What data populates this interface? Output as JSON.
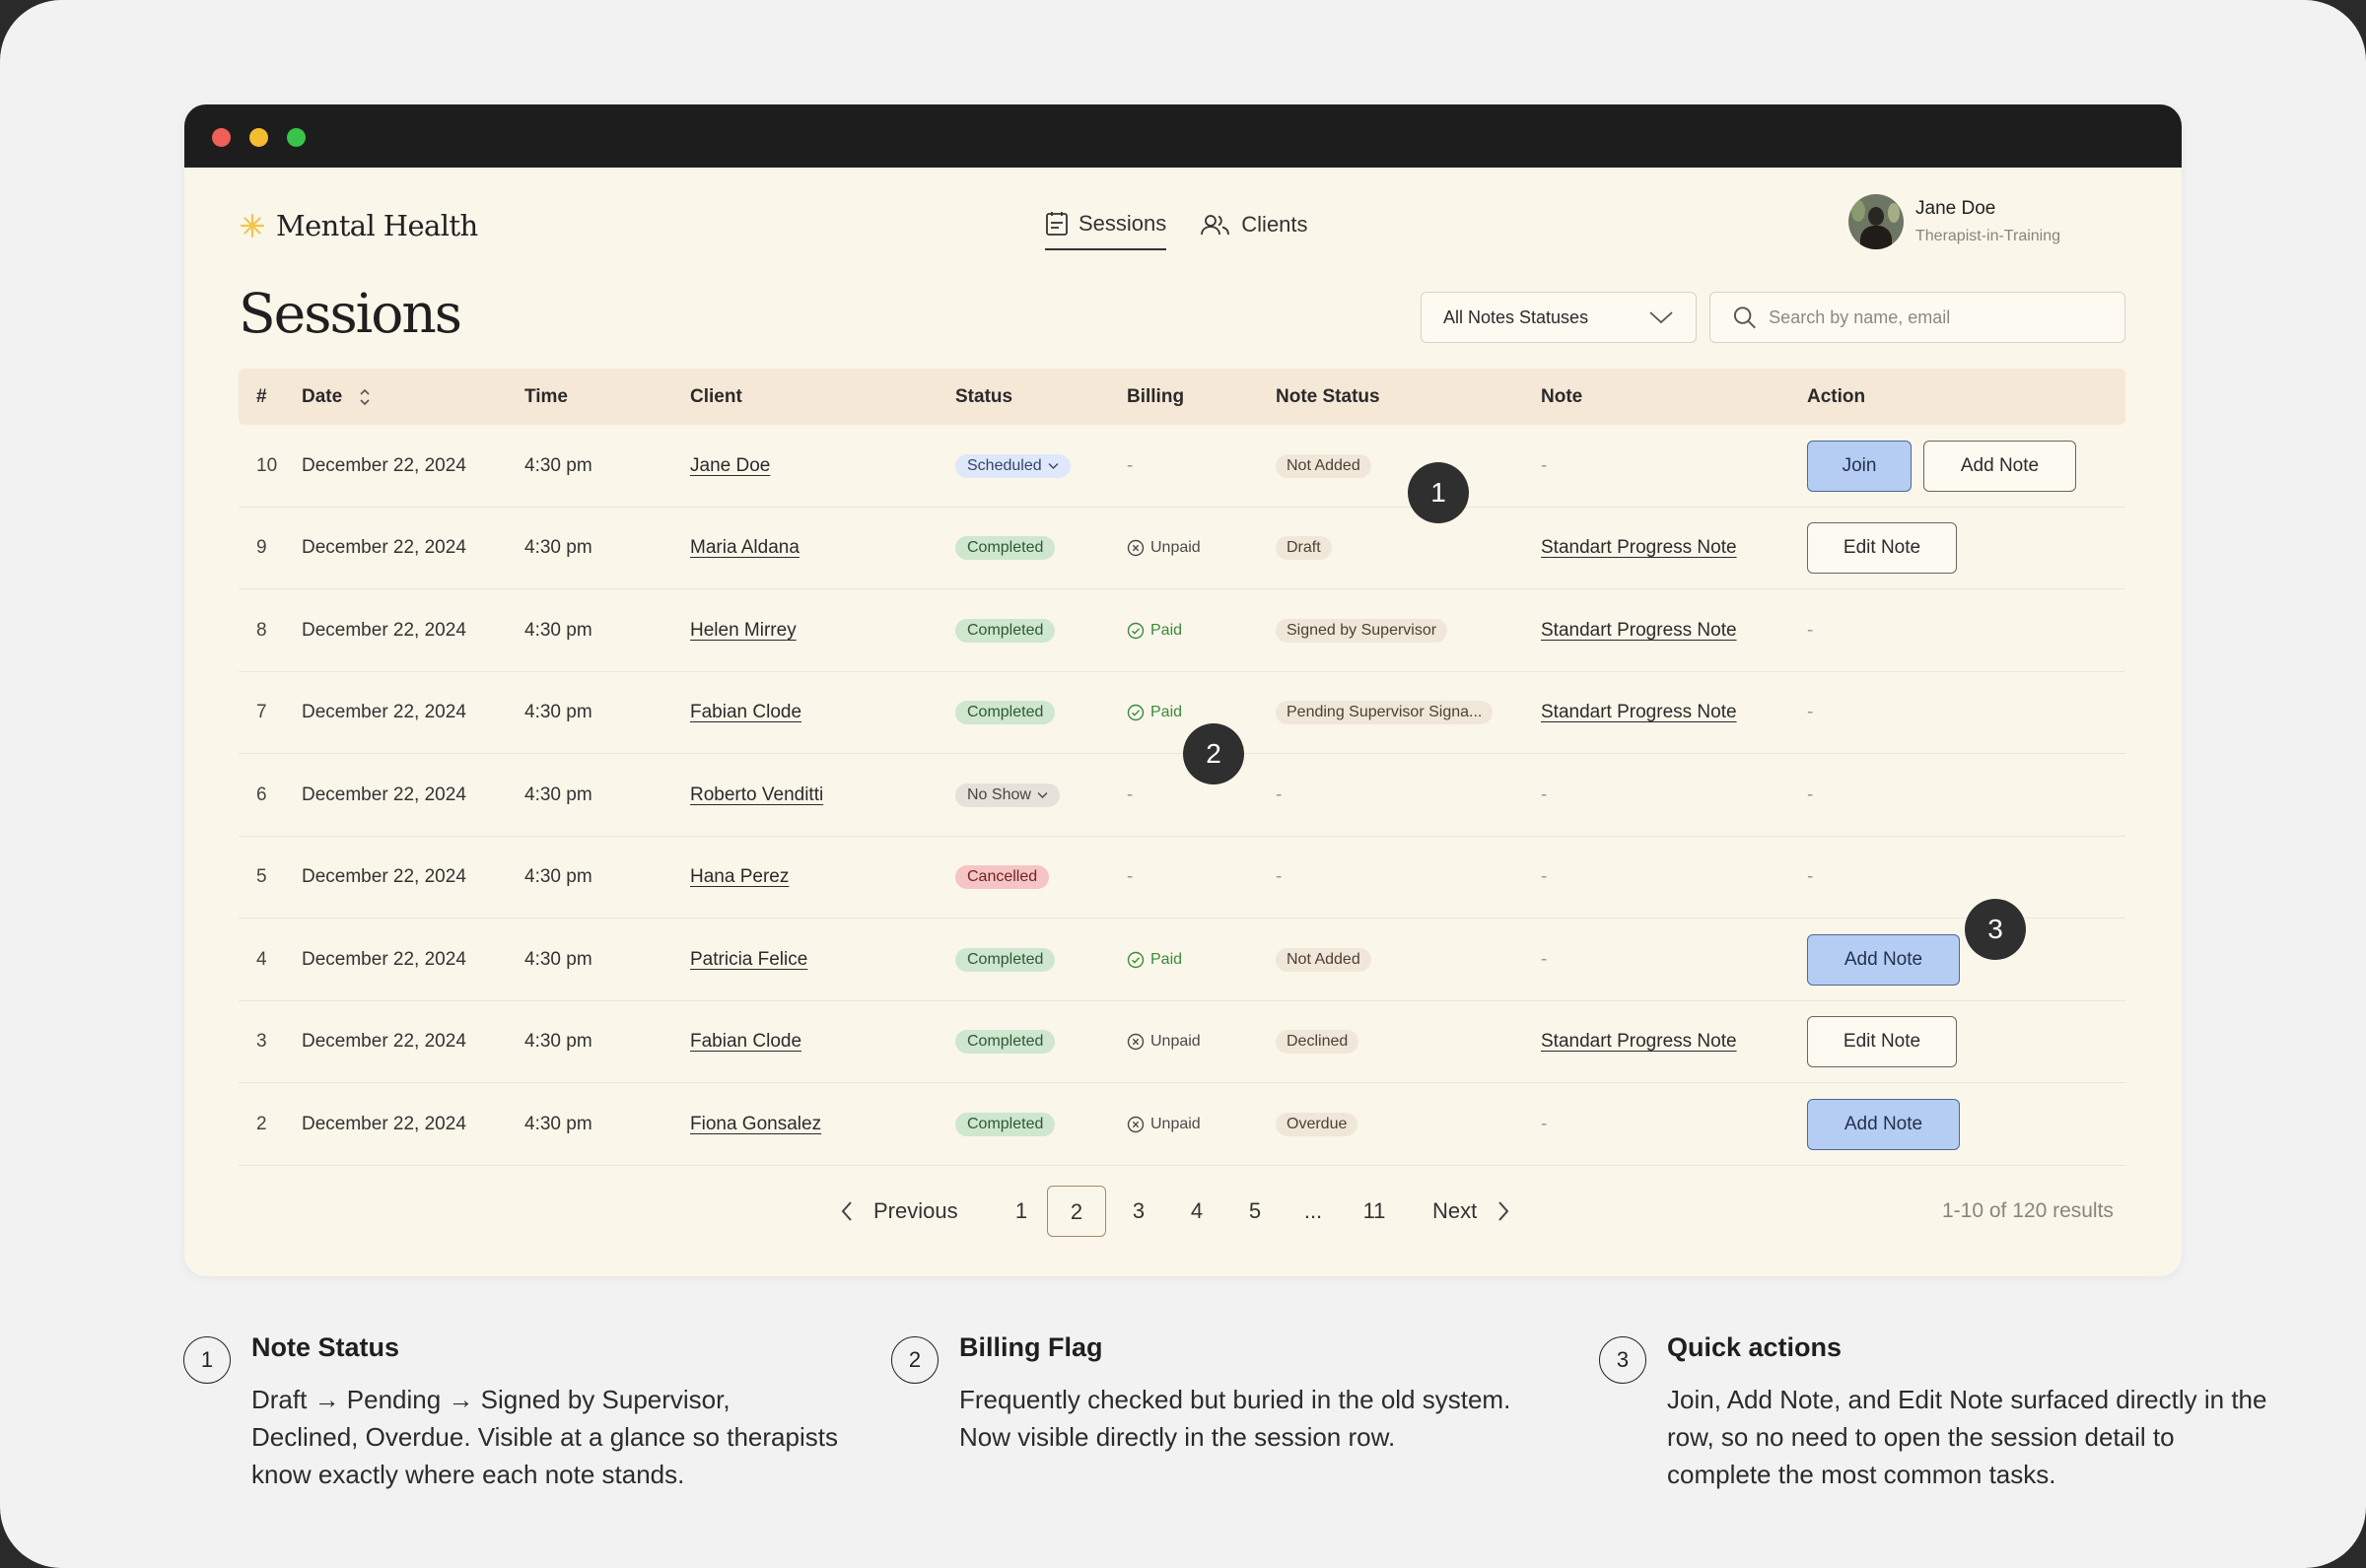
{
  "app": {
    "logo_text": "Mental Health",
    "nav": [
      {
        "label": "Sessions",
        "icon": "calendar-icon",
        "active": true
      },
      {
        "label": "Clients",
        "icon": "users-icon",
        "active": false
      }
    ],
    "user": {
      "name": "Jane Doe",
      "role": "Therapist-in-Training"
    }
  },
  "page": {
    "title": "Sessions",
    "filter_label": "All Notes Statuses",
    "search_placeholder": "Search by name, email"
  },
  "table": {
    "headers": {
      "index": "#",
      "date": "Date",
      "time": "Time",
      "client": "Client",
      "status": "Status",
      "billing": "Billing",
      "note_status": "Note Status",
      "note": "Note",
      "action": "Action"
    },
    "rows": [
      {
        "index": "10",
        "date": "December 22, 2024",
        "time": "4:30 pm",
        "client": "Jane Doe",
        "status": "Scheduled",
        "status_kind": "scheduled",
        "billing": "-",
        "billing_kind": "none",
        "note_status": "Not Added",
        "note": "-",
        "actions": [
          "Join",
          "Add Note"
        ]
      },
      {
        "index": "9",
        "date": "December 22, 2024",
        "time": "4:30 pm",
        "client": "Maria Aldana",
        "status": "Completed",
        "status_kind": "completed",
        "billing": "Unpaid",
        "billing_kind": "unpaid",
        "note_status": "Draft",
        "note": "Standart Progress Note",
        "actions": [
          "Edit Note"
        ]
      },
      {
        "index": "8",
        "date": "December 22, 2024",
        "time": "4:30 pm",
        "client": "Helen Mirrey",
        "status": "Completed",
        "status_kind": "completed",
        "billing": "Paid",
        "billing_kind": "paid",
        "note_status": "Signed by Supervisor",
        "note": "Standart Progress Note",
        "actions": []
      },
      {
        "index": "7",
        "date": "December 22, 2024",
        "time": "4:30 pm",
        "client": "Fabian Clode",
        "status": "Completed",
        "status_kind": "completed",
        "billing": "Paid",
        "billing_kind": "paid",
        "note_status": "Pending Supervisor Signa...",
        "note": "Standart Progress Note",
        "actions": []
      },
      {
        "index": "6",
        "date": "December 22, 2024",
        "time": "4:30 pm",
        "client": "Roberto Venditti",
        "status": "No Show",
        "status_kind": "noshow",
        "billing": "-",
        "billing_kind": "none",
        "note_status": "-",
        "note": "-",
        "actions": []
      },
      {
        "index": "5",
        "date": "December 22, 2024",
        "time": "4:30 pm",
        "client": "Hana Perez",
        "status": "Cancelled",
        "status_kind": "cancelled",
        "billing": "-",
        "billing_kind": "none",
        "note_status": "-",
        "note": "-",
        "actions": []
      },
      {
        "index": "4",
        "date": "December 22, 2024",
        "time": "4:30 pm",
        "client": "Patricia Felice",
        "status": "Completed",
        "status_kind": "completed",
        "billing": "Paid",
        "billing_kind": "paid",
        "note_status": "Not Added",
        "note": "-",
        "actions": [
          "Add Note"
        ]
      },
      {
        "index": "3",
        "date": "December 22, 2024",
        "time": "4:30 pm",
        "client": "Fabian Clode",
        "status": "Completed",
        "status_kind": "completed",
        "billing": "Unpaid",
        "billing_kind": "unpaid",
        "note_status": "Declined",
        "note": "Standart Progress Note",
        "actions": [
          "Edit Note"
        ]
      },
      {
        "index": "2",
        "date": "December 22, 2024",
        "time": "4:30 pm",
        "client": "Fiona Gonsalez",
        "status": "Completed",
        "status_kind": "completed",
        "billing": "Unpaid",
        "billing_kind": "unpaid",
        "note_status": "Overdue",
        "note": "-",
        "actions": [
          "Add Note"
        ]
      }
    ],
    "empty_action": "-"
  },
  "pagination": {
    "previous": "Previous",
    "next": "Next",
    "pages": [
      "1",
      "2",
      "3",
      "4",
      "5",
      "...",
      "11"
    ],
    "current": "2",
    "results": "1-10 of 120 results"
  },
  "callouts": [
    "1",
    "2",
    "3"
  ],
  "legend": [
    {
      "num": "1",
      "title": "Note Status",
      "text": "Draft → Pending → Signed by Supervisor, Declined, Overdue. Visible at a glance so therapists know exactly where each note stands."
    },
    {
      "num": "2",
      "title": "Billing Flag",
      "text": "Frequently checked but buried in the old system. Now visible directly in the session row."
    },
    {
      "num": "3",
      "title": "Quick actions",
      "text": "Join, Add Note, and Edit Note surfaced directly in the row, so no need to open the session detail to complete the most common tasks."
    }
  ],
  "colors": {
    "window_bg": "#faf6ea",
    "header_row": "#f6e8d7",
    "primary_button": "#b6cdf3",
    "completed": "#cfe6cf",
    "cancelled": "#f6c4c4",
    "scheduled": "#dfe7fa",
    "paid": "#3a8a3a"
  }
}
